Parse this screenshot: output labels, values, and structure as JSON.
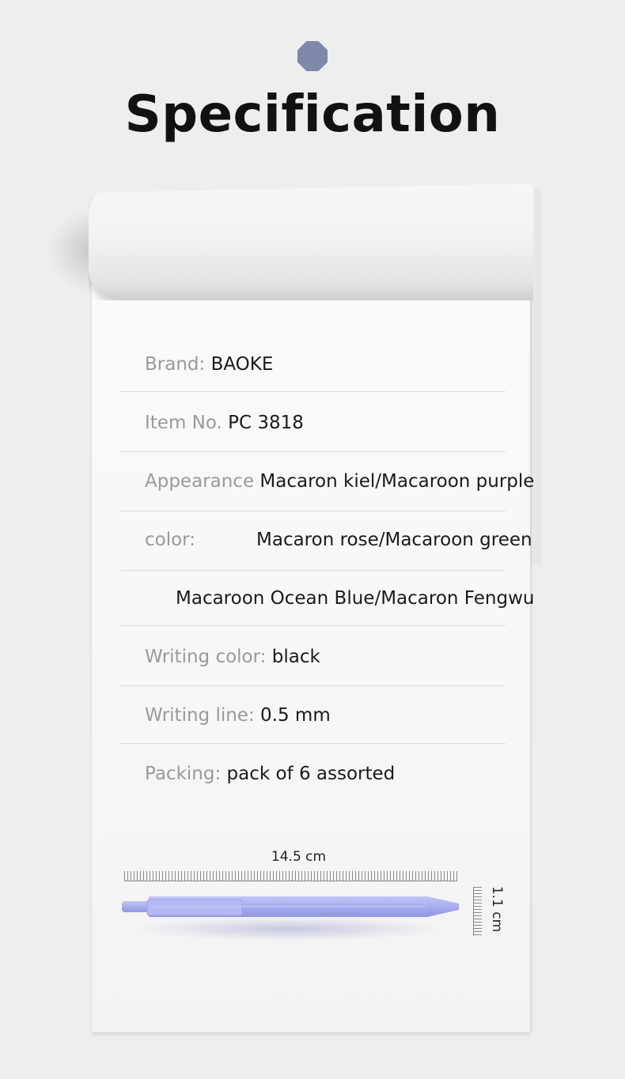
{
  "header": {
    "title": "Specification"
  },
  "specs": [
    {
      "label": "Brand:",
      "value": "BAOKE"
    },
    {
      "label": "Item No.",
      "value": "PC 3818"
    },
    {
      "label": "Appearance",
      "value": "Macaron kiel/Macaroon purple"
    },
    {
      "label": "color:",
      "value": "Macaron rose/Macaroon green"
    },
    {
      "label": "",
      "value": "Macaroon Ocean Blue/Macaron Fengwu"
    },
    {
      "label": "Writing color:",
      "value": "black"
    },
    {
      "label": "Writing line:",
      "value": "0.5 mm"
    },
    {
      "label": "Packing:",
      "value": "pack of 6 assorted"
    }
  ],
  "dimensions": {
    "length": "14.5 cm",
    "width": "1.1 cm"
  },
  "colors": {
    "pen": "#a9aef0",
    "accent_dot": "#8088aa"
  }
}
